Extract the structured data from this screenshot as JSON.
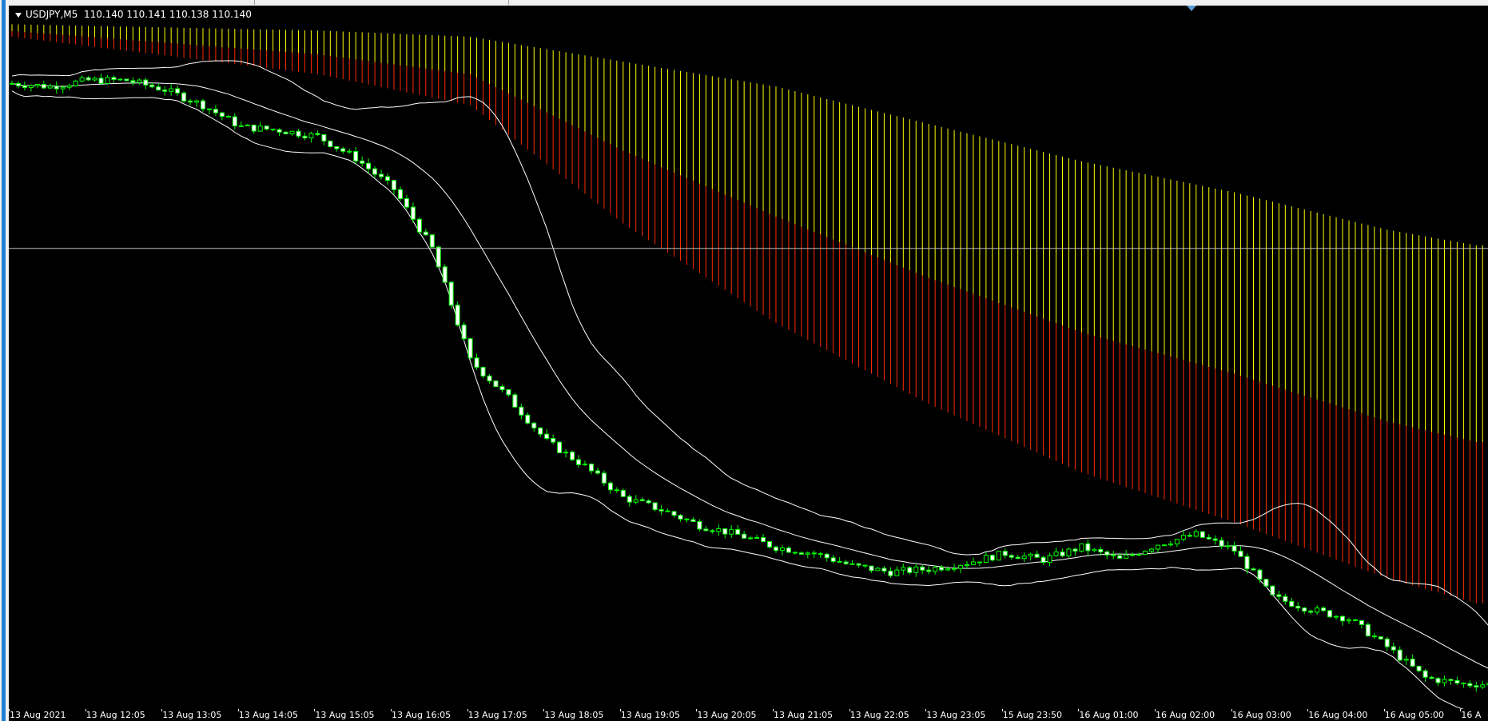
{
  "header": {
    "symbol": "USDJPY,M5",
    "ohlc": "110.140 110.141 110.138 110.140"
  },
  "colors": {
    "background": "#000000",
    "bull_candle": "#000000",
    "bear_candle": "#ffffff",
    "wick": "#00ff00",
    "bollinger": "#ffffff",
    "cloud_span_a": "#ff2a00",
    "cloud_span_b": "#ffff00",
    "crosshair": "#bdbdbd"
  },
  "chart_data": {
    "type": "candlestick",
    "symbol": "USDJPY",
    "timeframe": "M5",
    "indicators": [
      "Bollinger Bands",
      "Ichimoku Cloud"
    ],
    "x_labels": [
      "13 Aug 2021",
      "13 Aug 12:05",
      "13 Aug 13:05",
      "13 Aug 14:05",
      "13 Aug 15:05",
      "13 Aug 16:05",
      "13 Aug 17:05",
      "13 Aug 18:05",
      "13 Aug 19:05",
      "13 Aug 20:05",
      "13 Aug 21:05",
      "13 Aug 22:05",
      "13 Aug 23:05",
      "15 Aug 23:50",
      "16 Aug 01:00",
      "16 Aug 02:00",
      "16 Aug 03:00",
      "16 Aug 04:00",
      "16 Aug 05:00",
      "16 A"
    ],
    "bars_per_label": 12,
    "close_path": [
      [
        0,
        110.405
      ],
      [
        6,
        110.4
      ],
      [
        12,
        110.41
      ],
      [
        18,
        110.41
      ],
      [
        24,
        110.395
      ],
      [
        30,
        110.37
      ],
      [
        36,
        110.335
      ],
      [
        42,
        110.33
      ],
      [
        48,
        110.32
      ],
      [
        54,
        110.285
      ],
      [
        60,
        110.235
      ],
      [
        66,
        110.14
      ],
      [
        72,
        109.96
      ],
      [
        78,
        109.9
      ],
      [
        84,
        109.83
      ],
      [
        90,
        109.79
      ],
      [
        96,
        109.74
      ],
      [
        102,
        109.72
      ],
      [
        108,
        109.695
      ],
      [
        114,
        109.68
      ],
      [
        120,
        109.66
      ],
      [
        126,
        109.65
      ],
      [
        132,
        109.63
      ],
      [
        138,
        109.62
      ],
      [
        144,
        109.625
      ],
      [
        150,
        109.635
      ],
      [
        156,
        109.65
      ],
      [
        162,
        109.64
      ],
      [
        168,
        109.66
      ],
      [
        174,
        109.64
      ],
      [
        180,
        109.665
      ],
      [
        186,
        109.68
      ],
      [
        192,
        109.655
      ],
      [
        198,
        109.58
      ],
      [
        204,
        109.56
      ],
      [
        210,
        109.545
      ],
      [
        216,
        109.5
      ],
      [
        222,
        109.45
      ],
      [
        228,
        109.44
      ]
    ],
    "cloud_span_a": [
      [
        0,
        110.48
      ],
      [
        24,
        110.45
      ],
      [
        48,
        110.42
      ],
      [
        72,
        110.37
      ],
      [
        96,
        110.18
      ],
      [
        120,
        110.02
      ],
      [
        144,
        109.89
      ],
      [
        168,
        109.78
      ],
      [
        192,
        109.7
      ],
      [
        216,
        109.61
      ],
      [
        230,
        109.57
      ]
    ],
    "cloud_span_b": [
      [
        0,
        110.5
      ],
      [
        48,
        110.49
      ],
      [
        72,
        110.48
      ],
      [
        96,
        110.44
      ],
      [
        120,
        110.4
      ],
      [
        144,
        110.34
      ],
      [
        168,
        110.28
      ],
      [
        192,
        110.23
      ],
      [
        216,
        110.17
      ],
      [
        230,
        110.145
      ]
    ],
    "crosshair_price": 110.14
  }
}
